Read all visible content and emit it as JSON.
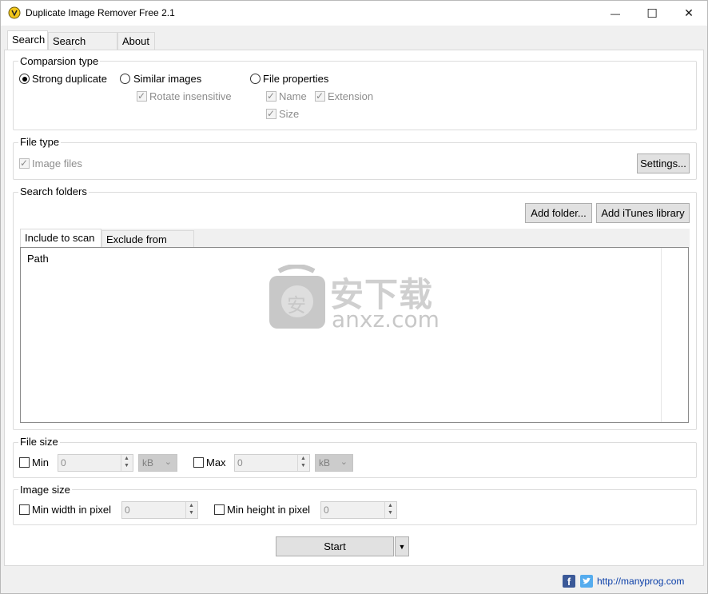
{
  "window": {
    "title": "Duplicate Image Remover Free 2.1",
    "controls": {
      "minimize": "—",
      "maximize": "☐",
      "close": "✕"
    }
  },
  "tabs": [
    {
      "label": "Search",
      "active": true
    },
    {
      "label": "Search result",
      "active": false
    },
    {
      "label": "About",
      "active": false
    }
  ],
  "comparison": {
    "label": "Comparsion type",
    "strong": "Strong duplicate",
    "similar": "Similar images",
    "rotate": "Rotate insensitive",
    "file_props": "File properties",
    "name": "Name",
    "extension": "Extension",
    "size": "Size"
  },
  "file_type": {
    "label": "File type",
    "image_files": "Image files",
    "settings_button": "Settings..."
  },
  "search_folders": {
    "label": "Search folders",
    "add_folder_button": "Add folder...",
    "add_itunes_button": "Add iTunes library",
    "tabs": [
      "Include to scan",
      "Exclude from scan"
    ],
    "column_path": "Path"
  },
  "file_size": {
    "label": "File size",
    "min_label": "Min",
    "min_value": "0",
    "min_unit": "kB",
    "max_label": "Max",
    "max_value": "0",
    "max_unit": "kB"
  },
  "image_size": {
    "label": "Image size",
    "min_width_label": "Min width in pixel",
    "min_width_value": "0",
    "min_height_label": "Min height in pixel",
    "min_height_value": "0"
  },
  "start_button": "Start",
  "watermark": {
    "glyph": "安",
    "cn": "安下载",
    "latin": "anxz.com"
  },
  "footer": {
    "link": "http://manyprog.com",
    "icons": [
      "facebook-icon",
      "twitter-icon"
    ]
  },
  "colors": {
    "accent_blue": "#0a3ea8",
    "facebook": "#3b5998",
    "twitter": "#55acee"
  }
}
